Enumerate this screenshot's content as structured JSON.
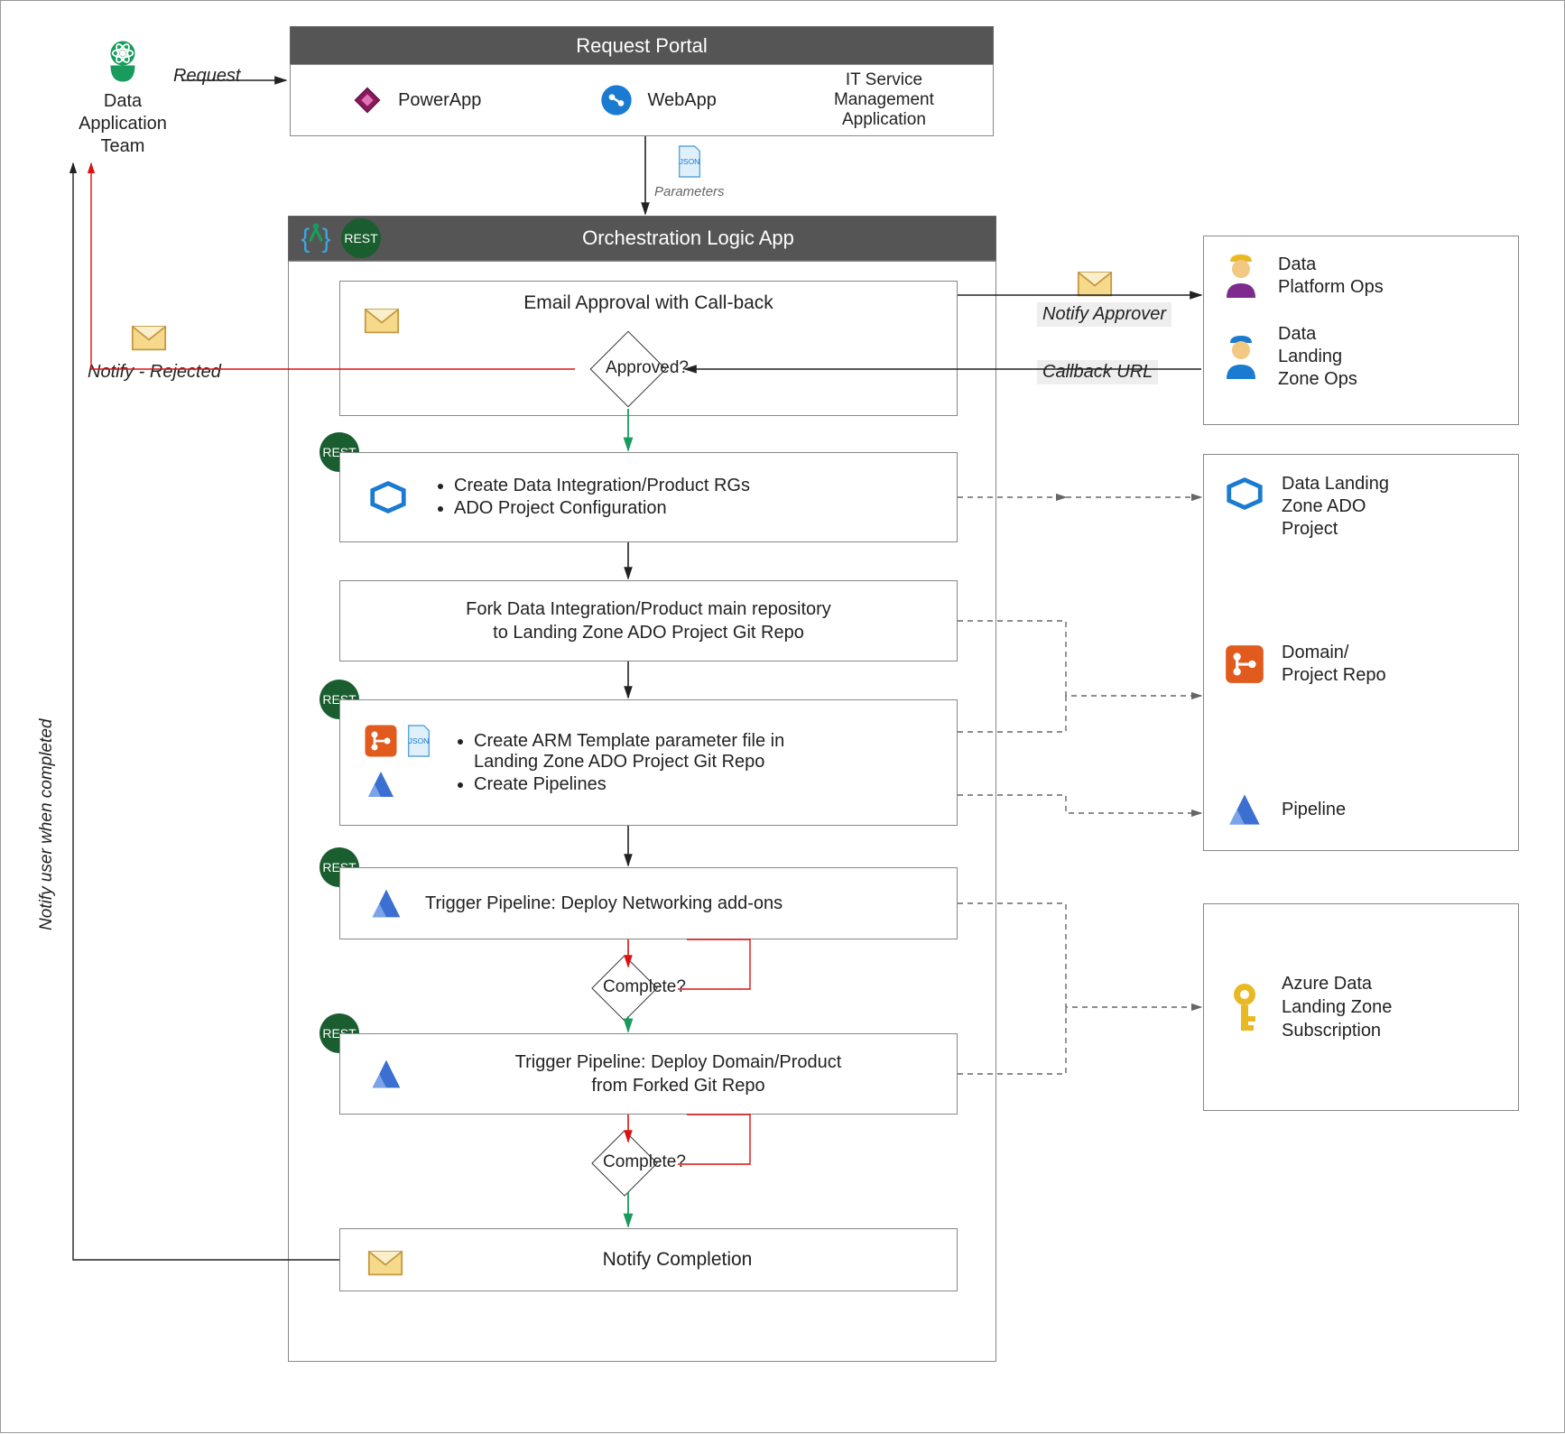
{
  "team": {
    "name": "Data\nApplication\nTeam"
  },
  "edges": {
    "request": "Request",
    "parameters": "Parameters",
    "notify_rejected": "Notify - Rejected",
    "notify_approver": "Notify Approver",
    "callback_url": "Callback URL",
    "notify_completed": "Notify user when completed"
  },
  "request_portal": {
    "title": "Request Portal",
    "items": [
      {
        "label": "PowerApp"
      },
      {
        "label": "WebApp"
      },
      {
        "label": "IT Service\nManagement\nApplication"
      }
    ]
  },
  "orchestration": {
    "title": "Orchestration Logic App",
    "rest": "REST",
    "steps": {
      "approval": {
        "title": "Email Approval with Call-back",
        "decision": "Approved?"
      },
      "rg": {
        "bullets": [
          "Create Data Integration/Product RGs",
          "ADO Project Configuration"
        ]
      },
      "fork": {
        "text": "Fork Data Integration/Product main repository\nto Landing Zone ADO Project Git Repo"
      },
      "arm": {
        "bullets": [
          "Create ARM Template parameter file in\nLanding Zone ADO Project Git Repo",
          "Create Pipelines"
        ]
      },
      "net": {
        "text": "Trigger Pipeline: Deploy Networking add-ons",
        "decision": "Complete?"
      },
      "deploy": {
        "text": "Trigger Pipeline: Deploy Domain/Product\nfrom Forked Git Repo",
        "decision": "Complete?"
      },
      "notify": {
        "text": "Notify Completion"
      }
    }
  },
  "approvers": {
    "ops1": "Data\nPlatform Ops",
    "ops2": "Data\nLanding\nZone Ops"
  },
  "external": {
    "ado": "Data Landing\nZone ADO\nProject",
    "repo": "Domain/\nProject Repo",
    "pipeline": "Pipeline",
    "sub": "Azure Data\nLanding Zone\nSubscription"
  }
}
